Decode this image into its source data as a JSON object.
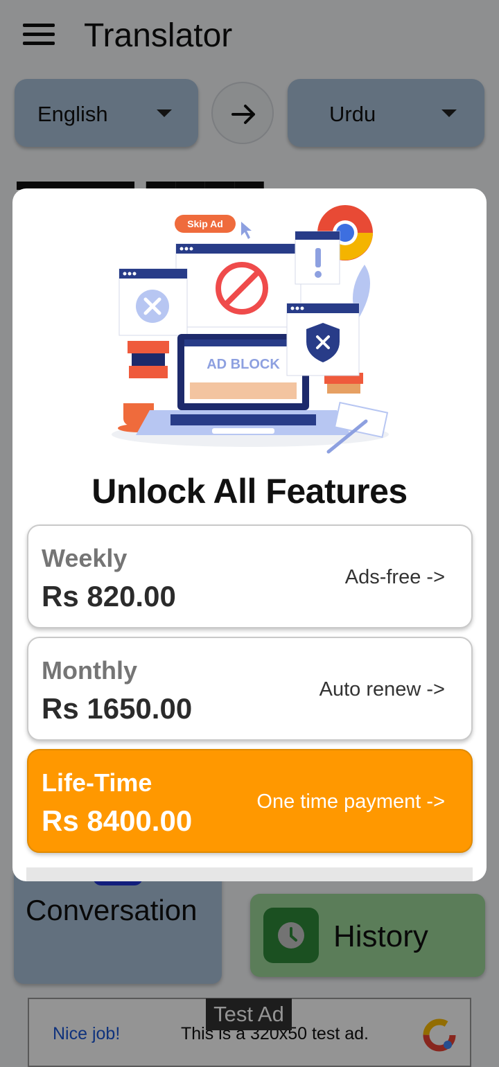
{
  "app": {
    "title": "Translator",
    "source_language": "English",
    "target_language": "Urdu"
  },
  "cards": {
    "conversation_label": "Conversation",
    "history_label": "History"
  },
  "ad": {
    "badge": "Test Ad",
    "nice_job": "Nice job!",
    "text": "This is a 320x50 test ad."
  },
  "dialog": {
    "illustration": {
      "skip_ad_label": "Skip Ad",
      "ad_block_label": "AD BLOCK"
    },
    "title": "Unlock All Features",
    "plans": [
      {
        "name": "Weekly",
        "price": "Rs 820.00",
        "note": "Ads-free ->"
      },
      {
        "name": "Monthly",
        "price": "Rs 1650.00",
        "note": "Auto renew ->"
      },
      {
        "name": "Life-Time",
        "price": "Rs 8400.00",
        "note": "One time payment ->"
      }
    ]
  },
  "colors": {
    "lang_button_bg": "#a9c2da",
    "history_bg": "#9ed79a",
    "lifetime_accent": "#ff9800",
    "scrim": "rgba(0,0,0,0.42)"
  },
  "icons": [
    "menu-icon",
    "arrow-right-icon",
    "dropdown-caret-icon",
    "clock-icon",
    "adblock-illustration",
    "ad-logo-icon"
  ]
}
